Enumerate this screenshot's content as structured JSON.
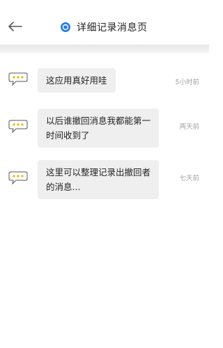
{
  "header": {
    "title": "详细记录消息页",
    "back_icon": "back-arrow-icon",
    "title_icon": "record-icon",
    "accent_color": "#2b7de1"
  },
  "messages": [
    {
      "text": "这应用真好用哇",
      "time": "5小时前",
      "icon": "chat-bubble-icon"
    },
    {
      "text": "以后谁撤回消息我都能第一时间收到了",
      "time": "两天前",
      "icon": "chat-bubble-icon"
    },
    {
      "text": "这里可以整理记录出撤回者的消息...",
      "time": "七天前",
      "icon": "chat-bubble-icon"
    }
  ],
  "colors": {
    "bubble_bg": "#efefef",
    "icon_dot": "#f0b400",
    "icon_stroke": "#555555",
    "time_text": "#a3a3a3"
  }
}
